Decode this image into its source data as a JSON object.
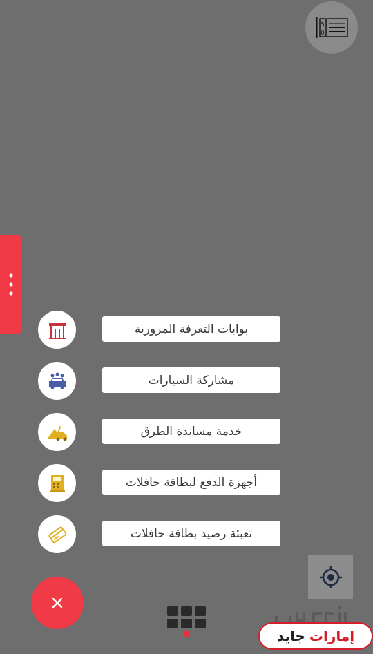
{
  "menu": {
    "items": [
      {
        "label": "بوابات التعرفة المرورية",
        "icon": "toll-gate-icon"
      },
      {
        "label": "مشاركة السيارات",
        "icon": "car-sharing-icon"
      },
      {
        "label": "خدمة مساندة الطرق",
        "icon": "roadside-assistance-icon"
      },
      {
        "label": "أجهزة الدفع لبطاقة حافلات",
        "icon": "payment-machine-icon"
      },
      {
        "label": "تعبئة رصيد بطاقة حافلات",
        "icon": "bus-card-topup-icon"
      }
    ]
  },
  "watermark": {
    "part1": "إمارات",
    "part2": "جايد"
  },
  "colors": {
    "background": "#6e6e6e",
    "accent_red": "#f03a46",
    "icon_red": "#c8323c",
    "icon_blue": "#4a5ea8",
    "icon_gold": "#e0b020",
    "text": "#3a3a3a"
  }
}
